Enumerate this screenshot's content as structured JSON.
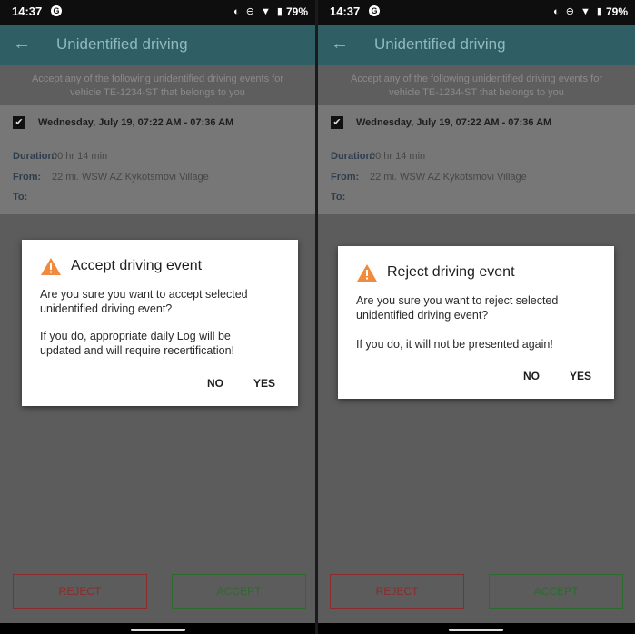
{
  "left": {
    "status": {
      "time": "14:37",
      "battery": "79%"
    },
    "appbar": {
      "title": "Unidentified driving"
    },
    "banner": {
      "line1": "Accept any of the following unidentified driving events for",
      "line2": "vehicle TE-1234-ST that belongs to you"
    },
    "event": {
      "date": "Wednesday, July 19, 07:22 AM - 07:36 AM",
      "duration_label": "Duration:",
      "duration_value": "00 hr 14 min",
      "from_label": "From:",
      "from_value": "22 mi. WSW AZ Kykotsmovi Village",
      "to_label": "To:"
    },
    "dialog": {
      "title": "Accept driving event",
      "message_line1": "Are you sure you want to accept selected",
      "message_line2": "unidentified driving event?",
      "note_line1": "If you do, appropriate daily Log will be",
      "note_line2": "updated and will require recertification!",
      "no_label": "NO",
      "yes_label": "YES"
    },
    "buttons": {
      "reject": "REJECT",
      "accept": "ACCEPT"
    }
  },
  "right": {
    "status": {
      "time": "14:37",
      "battery": "79%"
    },
    "appbar": {
      "title": "Unidentified driving"
    },
    "banner": {
      "line1": "Accept any of the following unidentified driving events for",
      "line2": "vehicle TE-1234-ST that belongs to you"
    },
    "event": {
      "date": "Wednesday, July 19, 07:22 AM - 07:36 AM",
      "duration_label": "Duration:",
      "duration_value": "00 hr 14 min",
      "from_label": "From:",
      "from_value": "22 mi. WSW AZ Kykotsmovi Village",
      "to_label": "To:"
    },
    "dialog": {
      "title": "Reject driving event",
      "message_line1": "Are you sure you want to reject selected",
      "message_line2": "unidentified driving event?",
      "note_line1": "If you do, it will not be presented again!",
      "no_label": "NO",
      "yes_label": "YES"
    },
    "buttons": {
      "reject": "REJECT",
      "accept": "ACCEPT"
    }
  }
}
